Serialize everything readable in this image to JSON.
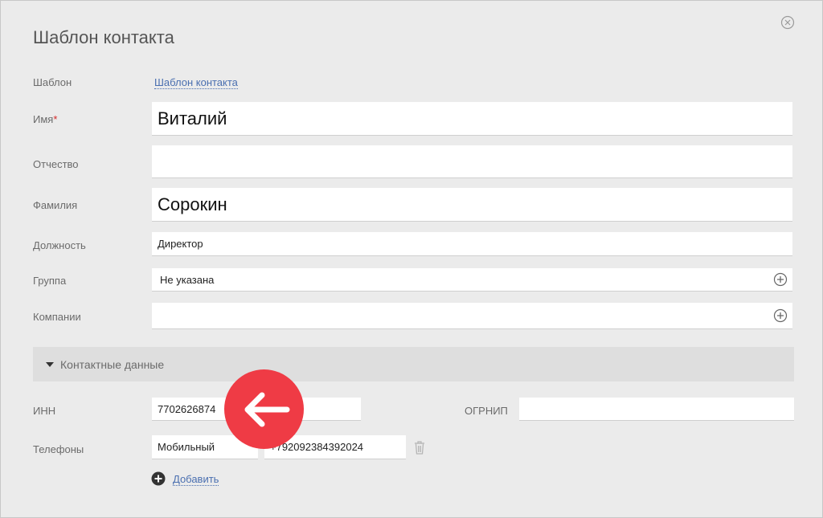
{
  "dialog": {
    "title": "Шаблон контакта"
  },
  "form": {
    "template": {
      "label": "Шаблон",
      "value": "Шаблон контакта"
    },
    "first_name": {
      "label": "Имя",
      "required_mark": "*",
      "value": "Виталий"
    },
    "middle_name": {
      "label": "Отчество",
      "value": ""
    },
    "last_name": {
      "label": "Фамилия",
      "value": "Сорокин"
    },
    "position": {
      "label": "Должность",
      "value": "Директор"
    },
    "group": {
      "label": "Группа",
      "value": "Не указана"
    },
    "companies": {
      "label": "Компании",
      "value": ""
    }
  },
  "contact_section": {
    "title": "Контактные данные",
    "inn": {
      "label": "ИНН",
      "value": "7702626874"
    },
    "ogrnip": {
      "label": "ОГРНИП",
      "value": ""
    },
    "phones": {
      "label": "Телефоны",
      "items": [
        {
          "type": "Мобильный",
          "number": "+792092384392024"
        }
      ],
      "add_label": "Добавить"
    }
  },
  "overlay": {
    "badge_color": "#ef3b45",
    "badge_icon": "arrow-left-icon"
  },
  "colors": {
    "background": "#ebebeb",
    "link": "#4a6fb0",
    "required": "#d42b2b"
  }
}
